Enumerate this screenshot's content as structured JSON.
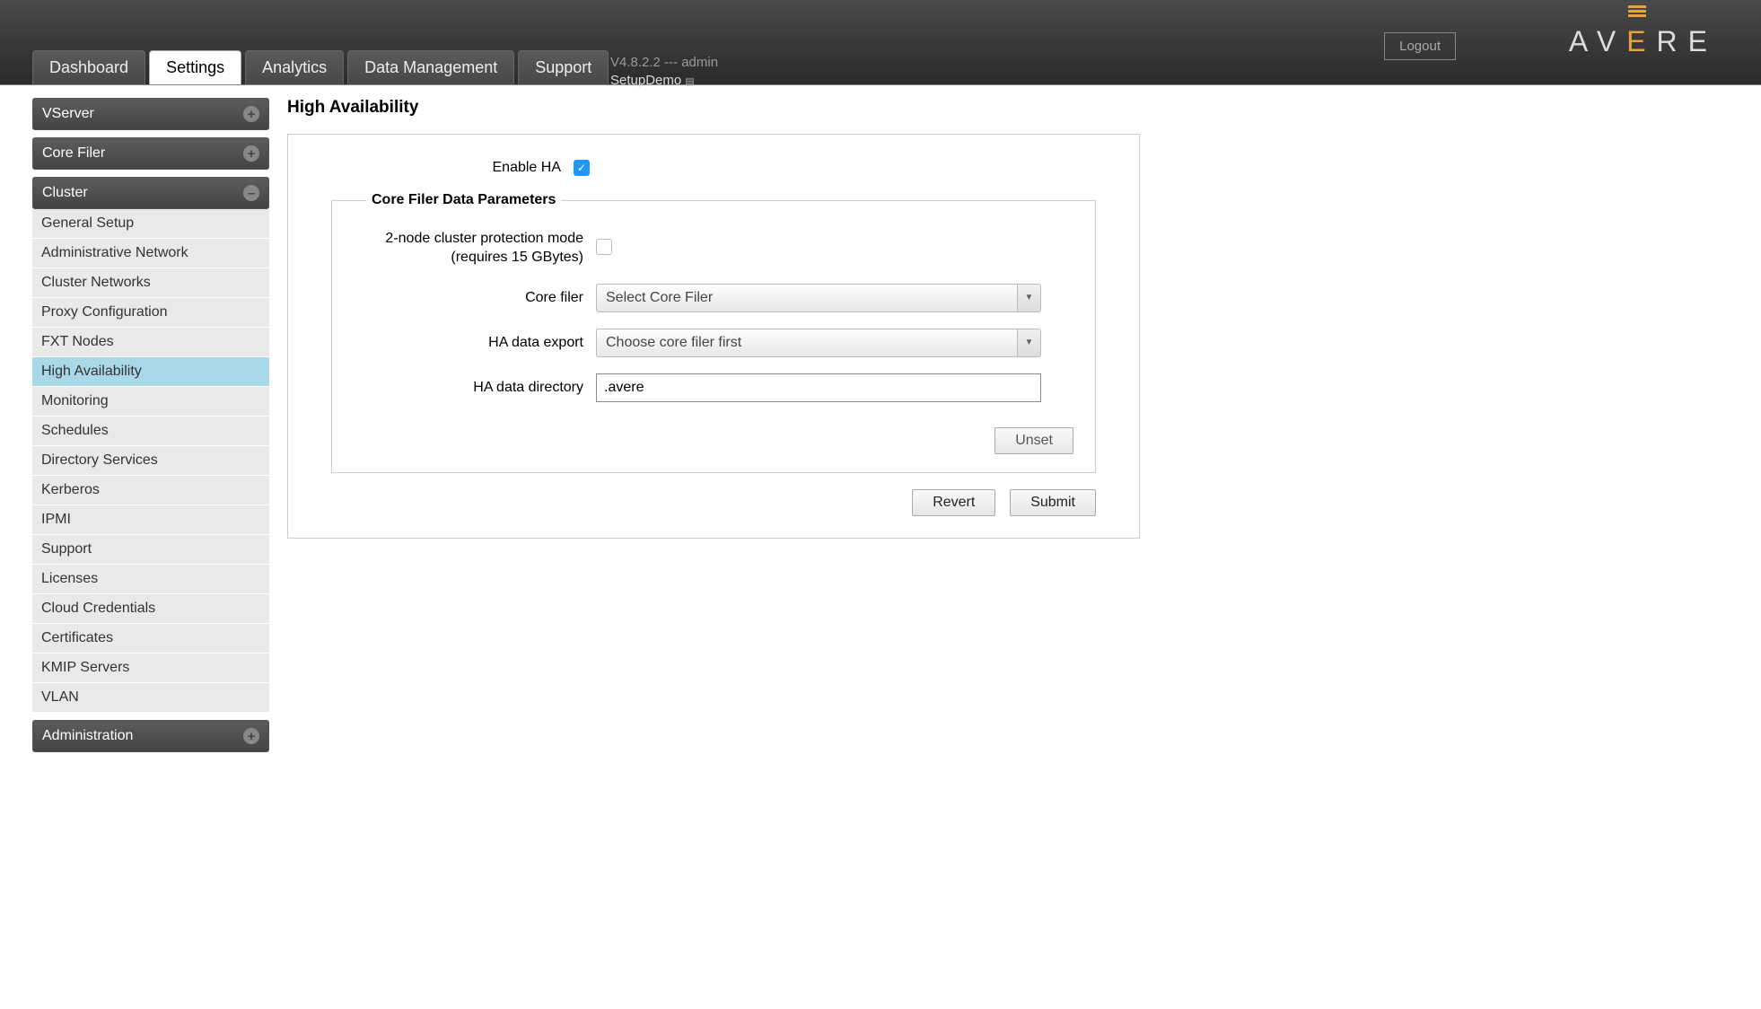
{
  "header": {
    "logout": "Logout",
    "logo": {
      "a": "A",
      "v": "V",
      "e": "E",
      "r": "R",
      "e2": "E"
    },
    "version_line": "V4.8.2.2 --- admin",
    "cluster_name": "SetupDemo"
  },
  "tabs": {
    "dashboard": "Dashboard",
    "settings": "Settings",
    "analytics": "Analytics",
    "data_mgmt": "Data Management",
    "support": "Support"
  },
  "sidebar": {
    "vserver": "VServer",
    "core_filer": "Core Filer",
    "cluster": "Cluster",
    "cluster_items": [
      "General Setup",
      "Administrative Network",
      "Cluster Networks",
      "Proxy Configuration",
      "FXT Nodes",
      "High Availability",
      "Monitoring",
      "Schedules",
      "Directory Services",
      "Kerberos",
      "IPMI",
      "Support",
      "Licenses",
      "Cloud Credentials",
      "Certificates",
      "KMIP Servers",
      "VLAN"
    ],
    "administration": "Administration"
  },
  "page": {
    "title": "High Availability",
    "enable_ha_label": "Enable HA",
    "fieldset_legend": "Core Filer Data Parameters",
    "two_node_label": "2-node cluster protection mode (requires 15 GBytes)",
    "core_filer_label": "Core filer",
    "core_filer_value": "Select Core Filer",
    "ha_export_label": "HA data export",
    "ha_export_value": "Choose core filer first",
    "ha_dir_label": "HA data directory",
    "ha_dir_value": ".avere",
    "unset": "Unset",
    "revert": "Revert",
    "submit": "Submit"
  }
}
